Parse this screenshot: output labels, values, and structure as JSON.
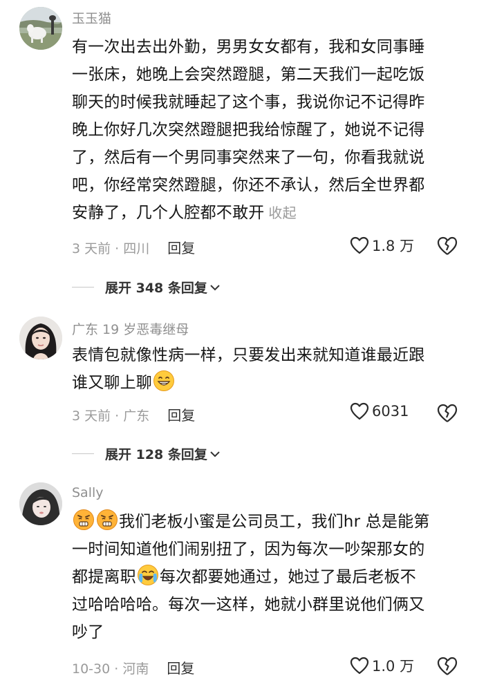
{
  "comments": [
    {
      "username": "玉玉猫",
      "lines": [
        "有一次出去出外勤，男男女女都有，我和女同事睡",
        "一张床，她晚上会突然蹬腿，第二天我们一起吃饭",
        "聊天的时候我就睡起了这个事，我说你记不记得昨",
        "晚上你好几次突然蹬腿把我给惊醒了，她说不记得",
        "了，然后有一个男同事突然来了一句，你看我就说",
        "吧，你经常突然蹬腿，你还不承认，然后全世界都",
        "安静了，几个人腔都不敢开"
      ],
      "collapse_label": "收起",
      "meta": "3 天前 · 四川",
      "reply_label": "回复",
      "like_count": "1.8 万",
      "expand_label": "展开 348 条回复"
    },
    {
      "username": "广东 19 岁恶毒继母",
      "line1": "表情包就像性病一样，只要发出来就知道谁最近跟",
      "line2": "谁又聊上聊",
      "meta": "3 天前 · 广东",
      "reply_label": "回复",
      "like_count": "6031",
      "expand_label": "展开 128 条回复"
    },
    {
      "username": "Sally",
      "line1": "我们老板小蜜是公司员工，我们hr 总是能第",
      "line2": "一时间知道他们闹别扭了，因为每次一吵架那女的",
      "line3a": "都提离职",
      "line3b": "每次都要她通过，她过了最后老板不",
      "line4": "过哈哈哈哈。每次一这样，她就小群里说他们俩又",
      "line5": "吵了",
      "meta": "10-30 · 河南",
      "reply_label": "回复",
      "like_count": "1.0 万"
    }
  ],
  "icons": {
    "like": "heart-outline-icon",
    "dislike": "broken-heart-icon",
    "expand": "chevron-down-icon",
    "emoji_grin": "grinning-emoji",
    "emoji_wink": "grimace-emoji",
    "emoji_cry": "crying-emoji"
  }
}
